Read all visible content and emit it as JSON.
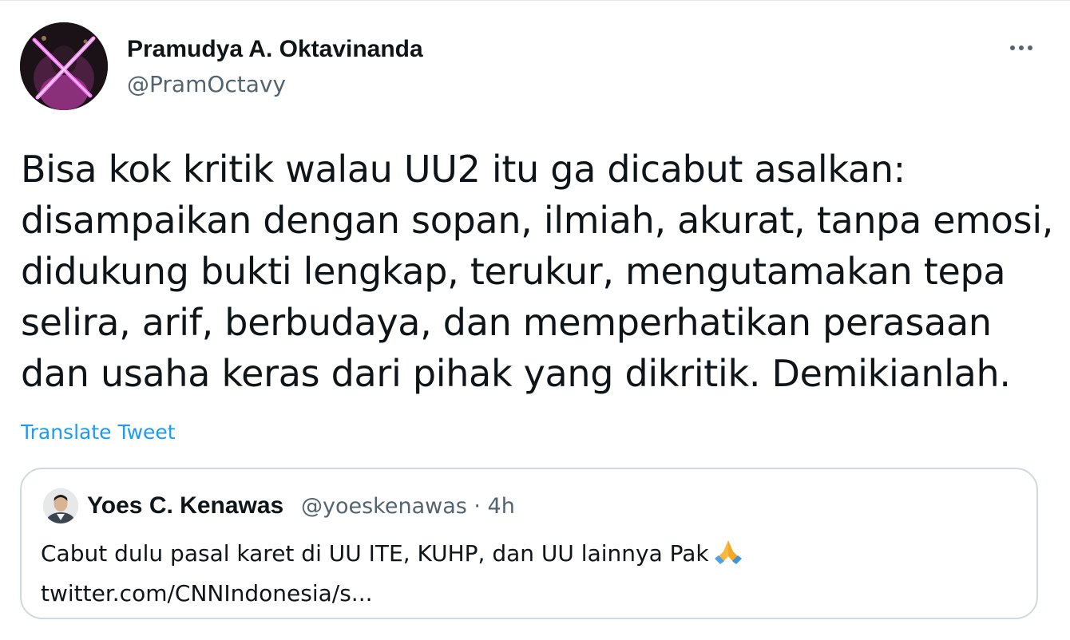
{
  "tweet": {
    "author": {
      "display_name": "Pramudya A. Oktavinanda",
      "handle": "@PramOctavy"
    },
    "more_icon": "more-horizontal-icon",
    "text_lines": [
      "Bisa kok kritik walau UU2 itu ga dicabut asalkan:",
      "disampaikan dengan sopan, ilmiah, akurat, tanpa emosi,",
      "didukung bukti lengkap, terukur, mengutamakan tepa",
      "selira, arif, berbudaya, dan memperhatikan perasaan",
      "dan usaha keras dari pihak yang dikritik. Demikianlah."
    ],
    "translate_label": "Translate Tweet",
    "accent_color": "#1d9bf0"
  },
  "quoted_tweet": {
    "author": {
      "display_name": "Yoes C. Kenawas",
      "handle_time": "@yoeskenawas · 4h"
    },
    "text_lines": [
      "Cabut dulu pasal karet di UU ITE, KUHP, dan UU lainnya Pak",
      "twitter.com/CNNIndonesia/s..."
    ],
    "emoji": "folded-hands-icon"
  }
}
